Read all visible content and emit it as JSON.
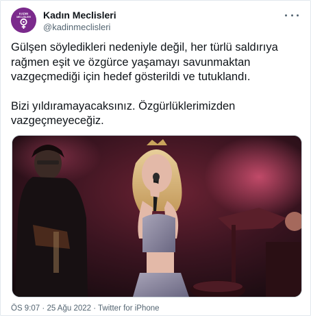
{
  "author": {
    "display_name": "Kadın Meclisleri",
    "handle": "@kadinmeclisleri",
    "avatar_text_line1": "KADIN",
    "avatar_text_line2": "MECLİSLERİ",
    "avatar_color": "#7b2a8c"
  },
  "tweet": {
    "paragraphs": [
      "Gülşen söyledikleri nedeniyle değil, her türlü saldırıya rağmen eşit ve özgürce yaşamayı savunmaktan vazgeçmediği için hedef gösterildi ve tutuklandı.",
      "Bizi yıldıramayacaksınız. Özgürlüklerimizden vazgeçmeyeceğiz."
    ],
    "time": "ÖS 9:07",
    "date": "25 Ağu 2022",
    "separator": " · ",
    "source": "Twitter for iPhone"
  },
  "icons": {
    "more": "more-options-icon",
    "avatar_symbol": "venus-symbol-icon"
  }
}
